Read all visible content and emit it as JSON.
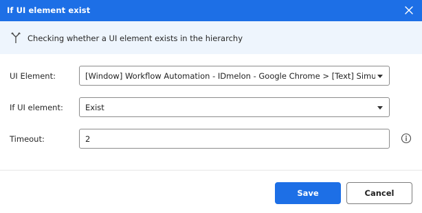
{
  "dialog": {
    "title": "If UI element exist",
    "close_icon": "close-icon"
  },
  "info": {
    "icon": "branch-icon",
    "text": "Checking whether a UI element exists in the hierarchy"
  },
  "form": {
    "ui_element": {
      "label": "UI Element:",
      "value": "[Window] Workflow Automation - IDmelon - Google Chrome > [Text] Simulates a"
    },
    "if_ui_element": {
      "label": "If UI element:",
      "value": "Exist"
    },
    "timeout": {
      "label": "Timeout:",
      "value": "2",
      "help_icon": "info-circle-icon"
    }
  },
  "actions": {
    "save_label": "Save",
    "cancel_label": "Cancel"
  },
  "colors": {
    "accent": "#1d6fe6",
    "info_bg": "#eef5fd"
  }
}
